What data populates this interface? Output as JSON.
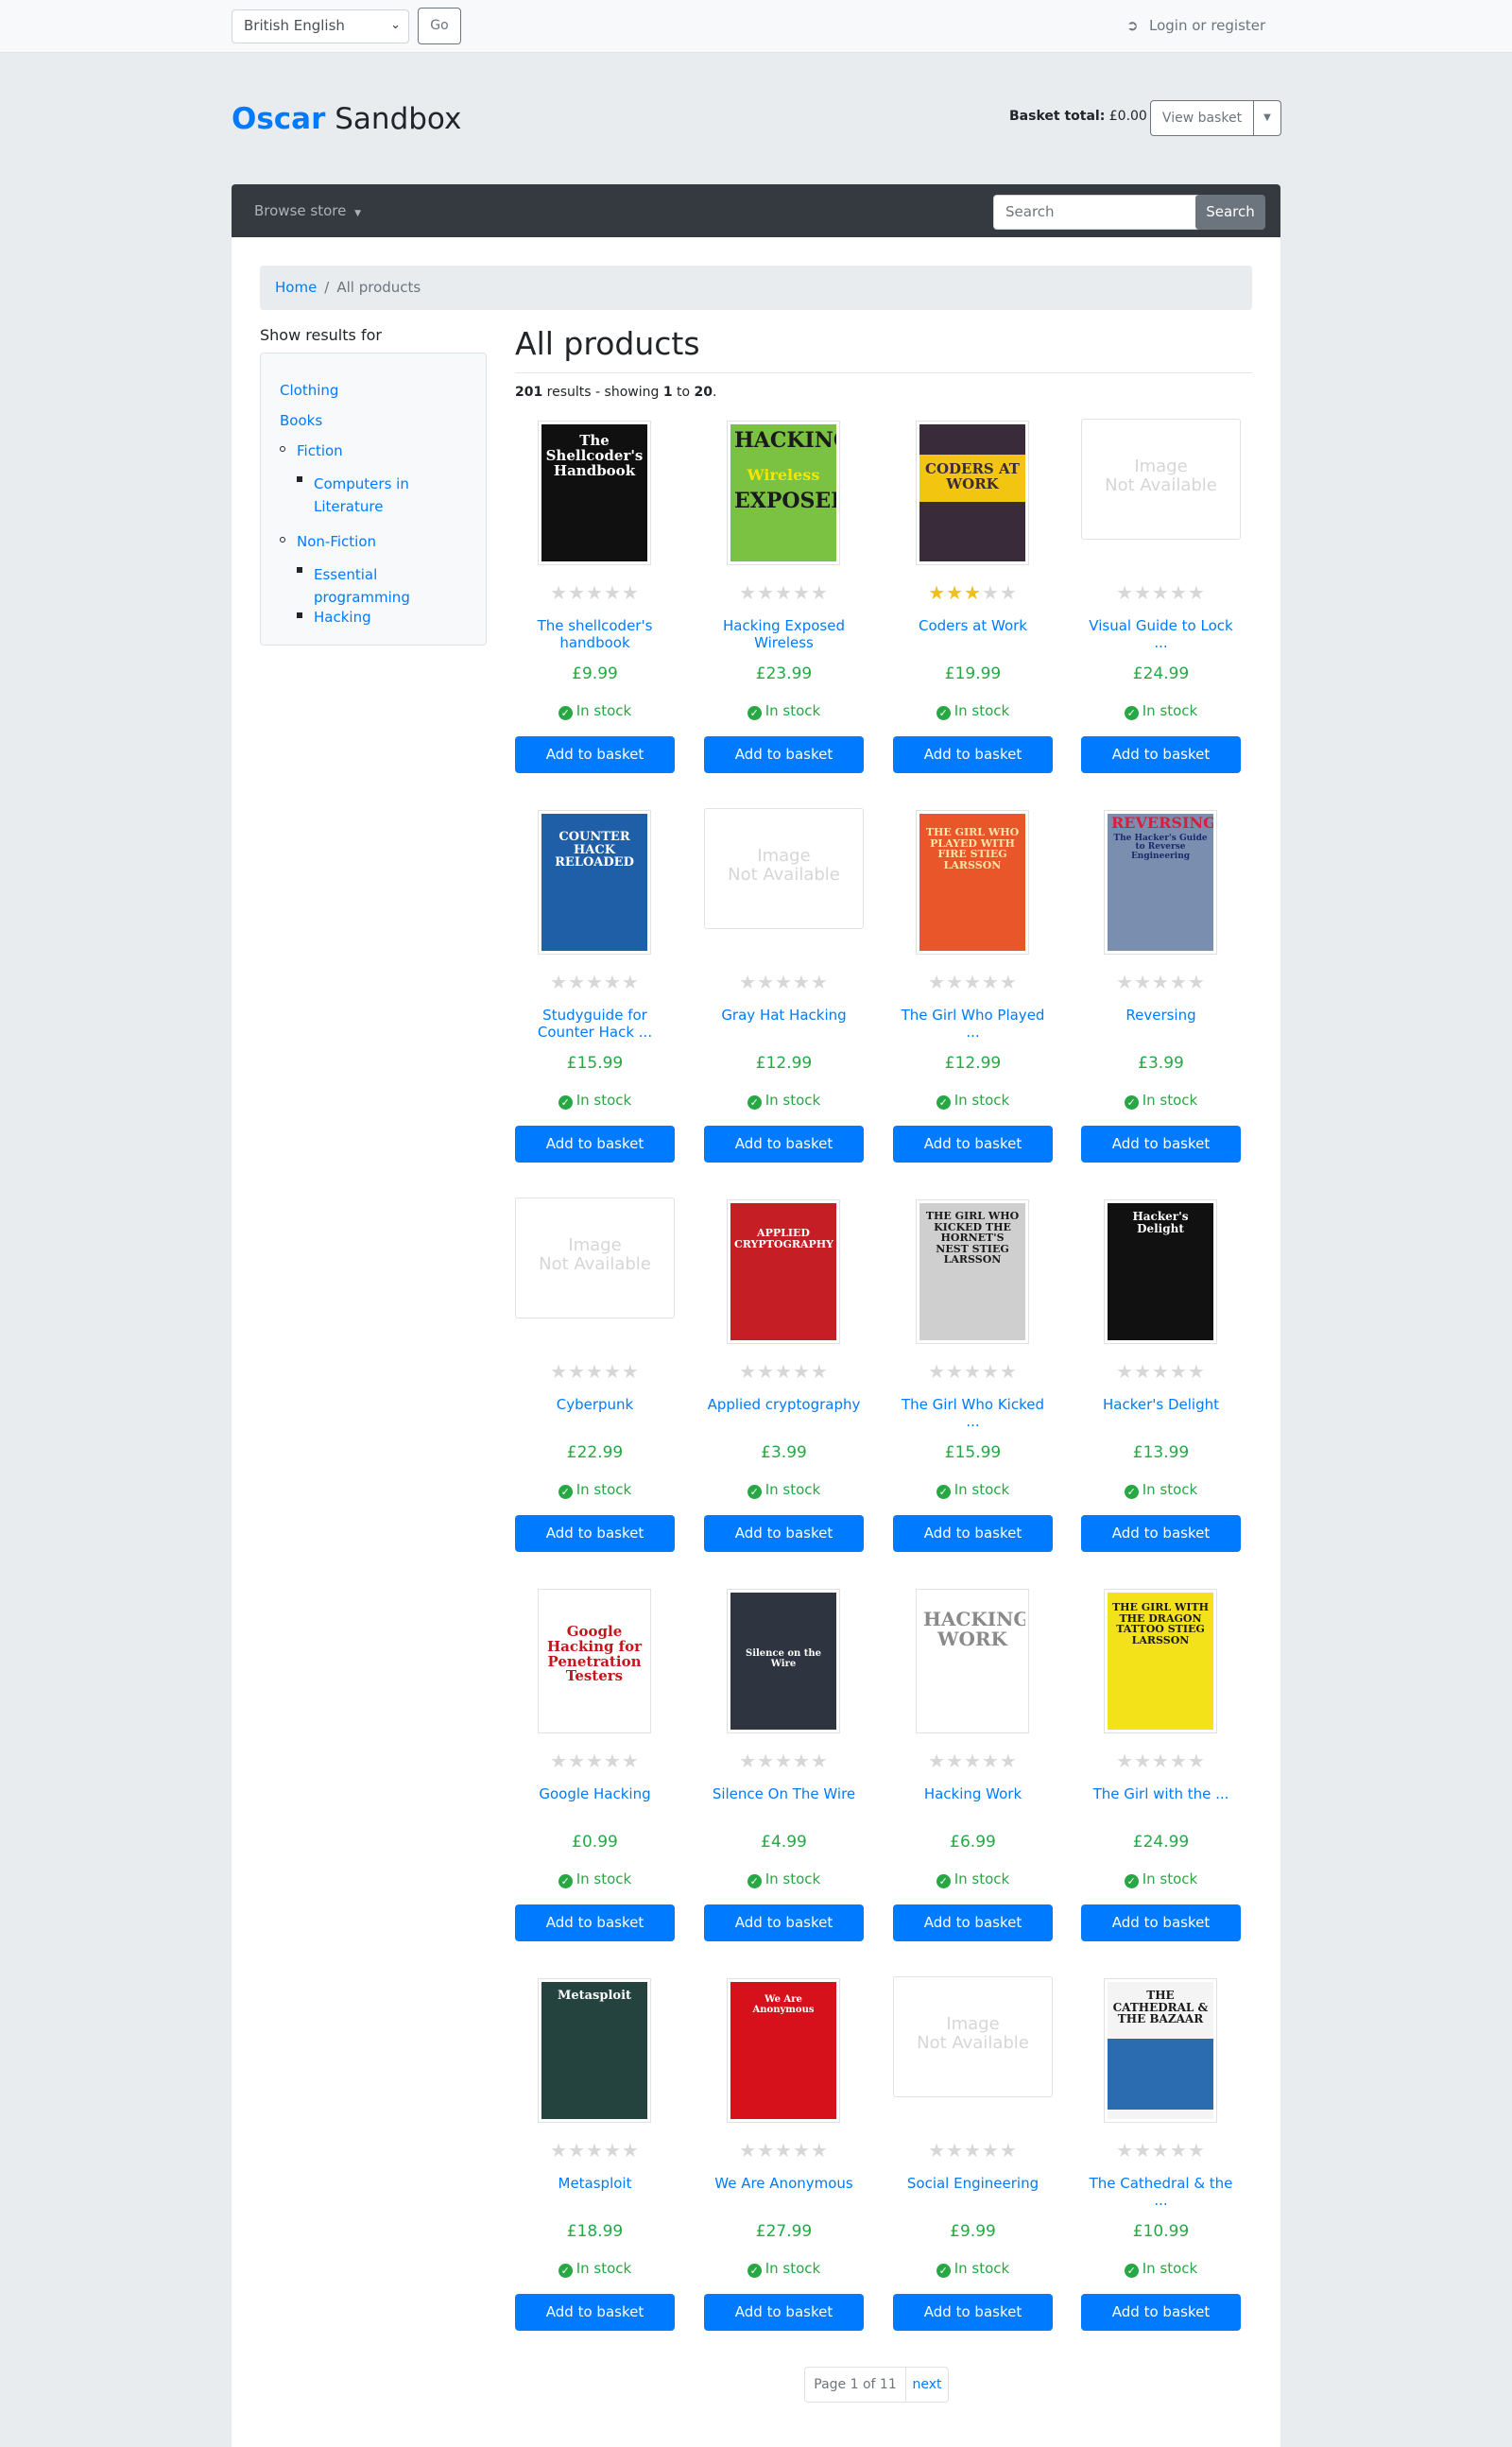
{
  "topbar": {
    "language": "British English",
    "go_label": "Go",
    "login_label": "Login or register"
  },
  "header": {
    "brand_primary": "Oscar",
    "brand_secondary": "Sandbox",
    "basket_total_label": "Basket total:",
    "basket_total_value": "£0.00",
    "view_basket_label": "View basket"
  },
  "nav": {
    "browse_label": "Browse store",
    "search_placeholder": "Search",
    "search_button": "Search"
  },
  "breadcrumb": {
    "home": "Home",
    "separator": "/",
    "current": "All products"
  },
  "sidebar": {
    "title": "Show results for",
    "items": {
      "clothing": "Clothing",
      "books": "Books",
      "fiction": "Fiction",
      "computers_line1": "Computers in",
      "computers_line2": "Literature",
      "nonfiction": "Non-Fiction",
      "essential_line1": "Essential",
      "essential_line2": "programming",
      "hacking": "Hacking"
    }
  },
  "main": {
    "title": "All products",
    "results_count": "201",
    "results_text1": " results - showing ",
    "results_from": "1",
    "results_to_text": " to ",
    "results_to": "20",
    "results_end": "."
  },
  "image_unavailable_text": "Image\nNot Available",
  "add_to_basket_label": "Add to basket",
  "in_stock_label": "In stock",
  "colors": {
    "accent": "#007bff",
    "price": "#28a745",
    "navbar": "#343a40",
    "star_on": "#f0bf1a",
    "star_off": "#d7d7d7"
  },
  "products": [
    {
      "title": "The shellcoder's handbook",
      "price": "£9.99",
      "rating": 0
    },
    {
      "title": "Hacking Exposed Wireless",
      "price": "£23.99",
      "rating": 0
    },
    {
      "title": "Coders at Work",
      "price": "£19.99",
      "rating": 3
    },
    {
      "title": "Visual Guide to Lock ...",
      "price": "£24.99",
      "rating": 0
    },
    {
      "title": "Studyguide for Counter Hack ...",
      "price": "£15.99",
      "rating": 0
    },
    {
      "title": "Gray Hat Hacking",
      "price": "£12.99",
      "rating": 0
    },
    {
      "title": "The Girl Who Played ...",
      "price": "£12.99",
      "rating": 0
    },
    {
      "title": "Reversing",
      "price": "£3.99",
      "rating": 0
    },
    {
      "title": "Cyberpunk",
      "price": "£22.99",
      "rating": 0
    },
    {
      "title": "Applied cryptography",
      "price": "£3.99",
      "rating": 0
    },
    {
      "title": "The Girl Who Kicked ...",
      "price": "£15.99",
      "rating": 0
    },
    {
      "title": "Hacker's Delight",
      "price": "£13.99",
      "rating": 0
    },
    {
      "title": "Google Hacking",
      "price": "£0.99",
      "rating": 0
    },
    {
      "title": "Silence On The Wire",
      "price": "£4.99",
      "rating": 0
    },
    {
      "title": "Hacking Work",
      "price": "£6.99",
      "rating": 0
    },
    {
      "title": "The Girl with the ...",
      "price": "£24.99",
      "rating": 0
    },
    {
      "title": "Metasploit",
      "price": "£18.99",
      "rating": 0
    },
    {
      "title": "We Are Anonymous",
      "price": "£27.99",
      "rating": 0
    },
    {
      "title": "Social Engineering",
      "price": "£9.99",
      "rating": 0
    },
    {
      "title": "The Cathedral & the ...",
      "price": "£10.99",
      "rating": 0
    }
  ],
  "covers": {
    "c0": "The Shellcoder's Handbook",
    "c1a": "HACKING",
    "c1b": "Wireless",
    "c1c": "EXPOSED",
    "c2": "CODERS AT WORK",
    "c4": "COUNTER HACK RELOADED",
    "c6": "THE GIRL WHO PLAYED WITH FIRE STIEG LARSSON",
    "c7a": "REVERSING:",
    "c7b": "The Hacker's Guide to Reverse Engineering",
    "c9": "APPLIED CRYPTOGRAPHY",
    "c10": "THE GIRL WHO KICKED THE HORNET'S NEST STIEG LARSSON",
    "c11": "Hacker's Delight",
    "c12": "Google Hacking for Penetration Testers",
    "c13": "Silence on the Wire",
    "c14": "HACKING WORK",
    "c15": "THE GIRL WITH THE DRAGON TATTOO STIEG LARSSON",
    "c16": "Metasploit",
    "c17": "We Are Anonymous",
    "c19": "THE CATHEDRAL & THE BAZAAR"
  },
  "pagination": {
    "current": "Page 1 of 11",
    "next": "next"
  }
}
